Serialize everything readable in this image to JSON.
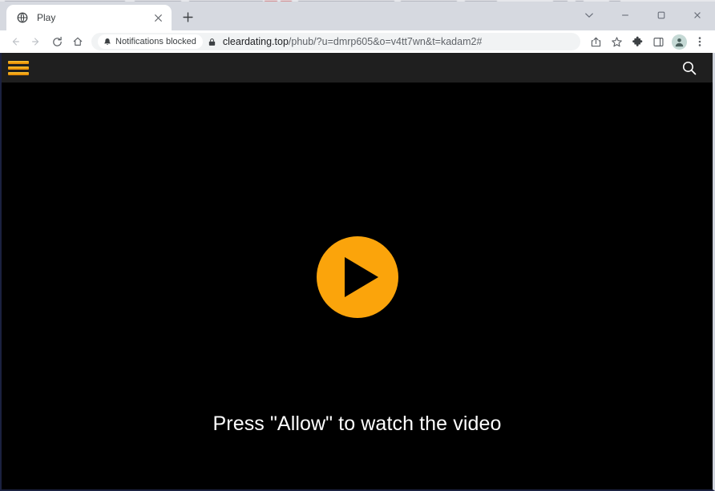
{
  "window": {
    "controls": [
      {
        "name": "tab-search",
        "glyph": "tab-search-chevron-icon"
      },
      {
        "name": "minimize",
        "glyph": "minimize-icon"
      },
      {
        "name": "maximize",
        "glyph": "maximize-icon"
      },
      {
        "name": "close",
        "glyph": "close-icon"
      }
    ]
  },
  "tabs": {
    "active": {
      "title": "Play",
      "favicon": "globe-icon",
      "close_label": "×"
    },
    "new_tab_label": "+"
  },
  "toolbar": {
    "back_label": "←",
    "forward_label": "→",
    "reload_label": "⟳",
    "home_label": "⌂",
    "share_icon": "share-icon",
    "bookmark_icon": "bookmark-star-icon",
    "extensions_icon": "extensions-puzzle-icon",
    "side_panel_icon": "side-panel-icon",
    "profile_icon": "profile-avatar-icon",
    "menu_label": "⋮"
  },
  "omnibox": {
    "notifications_chip": {
      "icon": "bell-icon",
      "label": "Notifications blocked"
    },
    "lock_icon": "lock-icon",
    "url_host": "cleardating.top",
    "url_path": "/phub/?u=dmrp605&o=v4tt7wn&t=kadam2#",
    "url_full": "cleardating.top/phub/?u=dmrp605&o=v4tt7wn&t=kadam2#"
  },
  "site": {
    "header": {
      "menu_icon": "hamburger-menu-icon",
      "search_icon": "search-icon"
    },
    "player": {
      "play_icon": "play-triangle-icon",
      "caption": "Press \"Allow\" to watch the video"
    }
  },
  "colors": {
    "accent_orange": "#fba40b",
    "page_black": "#000000",
    "site_header": "#1f1f1f",
    "chrome_frame": "#d6d9e0"
  }
}
